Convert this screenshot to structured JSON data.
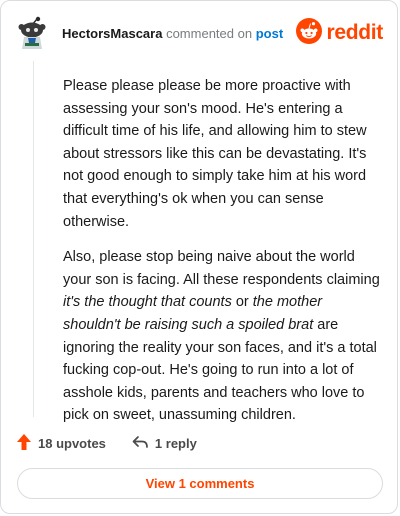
{
  "header": {
    "username": "HectorsMascara",
    "commented_text": "commented on",
    "post_link": "post",
    "brand": "reddit"
  },
  "comment": {
    "p1": "Please please please be more proactive with assessing your son's mood. He's entering a difficult time of his life, and allowing him to stew about stressors like this can be devastating. It's not good enough to simply take him at his word that everything's ok when you can sense otherwise.",
    "p2_a": "Also, please stop being naive about the world your son is facing. All these respondents claiming ",
    "p2_em1": "it's the thought that counts",
    "p2_b": " or ",
    "p2_em2": "the mother shouldn't be raising such a spoiled brat",
    "p2_c": " are ignoring the reality your son faces, and it's a total fucking cop-out. He's going to run into a lot of asshole kids, parents and teachers who love to pick on sweet, unassuming children."
  },
  "actions": {
    "upvotes": "18 upvotes",
    "reply": "1 reply"
  },
  "view_button": "View 1 comments",
  "colors": {
    "brand_orange": "#ff4500",
    "link_blue": "#0079d3",
    "muted_gray": "#787c7e"
  }
}
